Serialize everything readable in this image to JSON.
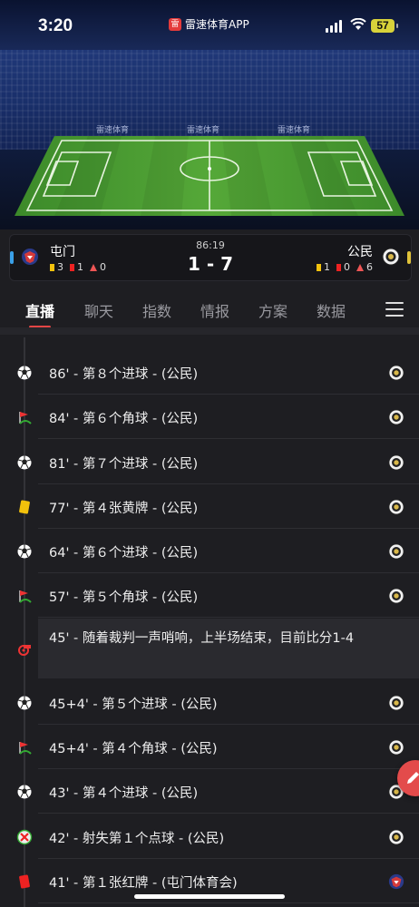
{
  "status_bar": {
    "time": "3:20",
    "app_name": "雷速体育APP",
    "app_logo_text": "雷",
    "battery": "57"
  },
  "stadium": {
    "brand_text": "雷速体育"
  },
  "match": {
    "minute": "86:19",
    "score": "1 - 7",
    "home": {
      "name": "屯门",
      "yellow": "3",
      "red": "1",
      "corners": "0",
      "strip_color": "#3aa0e8"
    },
    "away": {
      "name": "公民",
      "yellow": "1",
      "red": "0",
      "corners": "6",
      "strip_color": "#e0c23a"
    }
  },
  "tabs": [
    "直播",
    "聊天",
    "指数",
    "情报",
    "方案",
    "数据"
  ],
  "active_tab": "直播",
  "events": [
    {
      "text": "86' - 第８个进球 - (公民)",
      "icon": "goal-icon",
      "team": "away"
    },
    {
      "text": "84' - 第６个角球 - (公民)",
      "icon": "corner-flag-icon",
      "team": "away"
    },
    {
      "text": "81' - 第７个进球 - (公民)",
      "icon": "goal-icon",
      "team": "away"
    },
    {
      "text": "77' - 第４张黄牌 - (公民)",
      "icon": "yellow-card-icon",
      "team": "away"
    },
    {
      "text": "64' - 第６个进球 - (公民)",
      "icon": "goal-icon",
      "team": "away"
    },
    {
      "text": "57' - 第５个角球 - (公民)",
      "icon": "corner-flag-icon",
      "team": "away"
    },
    {
      "text": "45' - 随着裁判一声哨响，上半场结束，目前比分1-4",
      "icon": "whistle-icon",
      "team": ""
    },
    {
      "text": "45+4' - 第５个进球 - (公民)",
      "icon": "goal-icon",
      "team": "away"
    },
    {
      "text": "45+4' - 第４个角球 - (公民)",
      "icon": "corner-flag-icon",
      "team": "away"
    },
    {
      "text": "43' - 第４个进球 - (公民)",
      "icon": "goal-icon",
      "team": "away"
    },
    {
      "text": "42' - 射失第１个点球 - (公民)",
      "icon": "missed-penalty-icon",
      "team": "away"
    },
    {
      "text": "41' - 第１张红牌 - (屯门体育会)",
      "icon": "red-card-icon",
      "team": "home"
    }
  ]
}
